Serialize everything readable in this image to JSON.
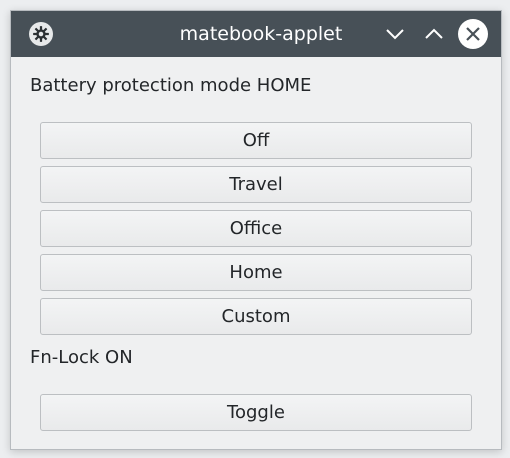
{
  "window": {
    "title": "matebook-applet",
    "icons": {
      "app": "gear-icon",
      "minimize": "chevron-down-icon",
      "maximize": "chevron-up-icon",
      "close": "close-icon"
    },
    "colors": {
      "titlebar": "#475057",
      "background": "#eff0f1"
    }
  },
  "battery": {
    "label": "Battery protection mode HOME",
    "buttons": [
      "Off",
      "Travel",
      "Office",
      "Home",
      "Custom"
    ]
  },
  "fnlock": {
    "label": "Fn-Lock ON",
    "toggle_label": "Toggle"
  }
}
